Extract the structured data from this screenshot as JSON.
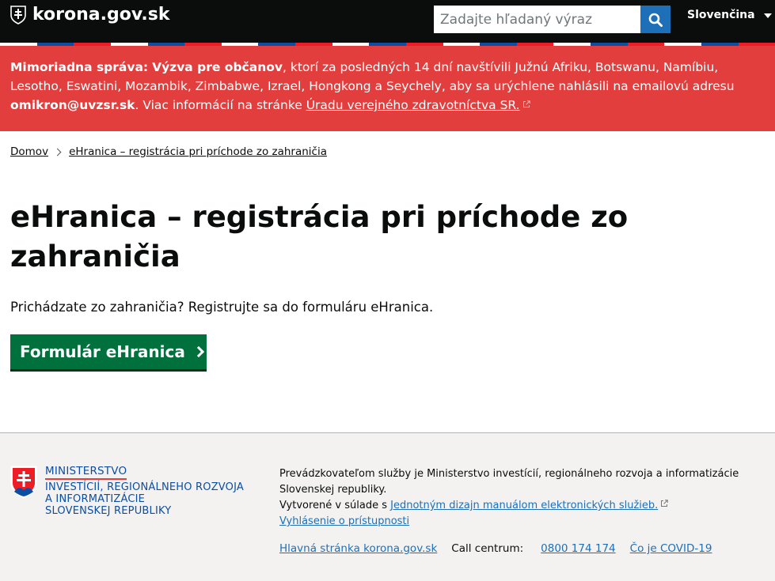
{
  "header": {
    "site_name": "korona.gov.sk",
    "search": {
      "placeholder": "Zadajte hľadaný výraz"
    },
    "language": "Slovenčina"
  },
  "alert": {
    "label": "Mimoriadna správa:",
    "headline": "Výzva pre občanov",
    "text_before_email": ", ktorí za posledných 14 dní navštívili Južnú Afriku, Botswanu, Namíbiu, Lesotho, Eswatini, Mozambik, Zimbabwe, Izrael, Hongkong a Seychely, aby sa urýchlene nahlásili na emailovú adresu ",
    "email": "omikron@uvzsr.sk",
    "text_after_email": ". Viac informácií na stránke ",
    "link": "Úradu verejného zdravotníctva SR."
  },
  "breadcrumb": {
    "home": "Domov",
    "current": "eHranica – registrácia pri príchode zo zahraničia"
  },
  "main": {
    "title": "eHranica – registrácia pri príchode zo zahraničia",
    "lead": "Prichádzate zo zahraničia? Registrujte sa do formuláru eHranica.",
    "cta": "Formulár eHranica"
  },
  "footer": {
    "ministry_logo": {
      "line1": "MINISTERSTVO",
      "line2": "INVESTÍCIÍ, REGIONÁLNEHO ROZVOJA",
      "line3": "A INFORMATIZÁCIE",
      "line4": "SLOVENSKEJ REPUBLIKY"
    },
    "operator": "Prevádzkovateľom služby je Ministerstvo investícií, regionálneho rozvoja a informatizácie Slovenskej republiky.",
    "created_prefix": "Vytvorené v súlade s ",
    "design_manual_link": "Jednotným dizajn manuálom elektronických služieb.",
    "accessibility_link": "Vyhlásenie o prístupnosti",
    "links": {
      "home": "Hlavná stránka korona.gov.sk",
      "call_label": "Call centrum:",
      "phone": "0800 174 174",
      "covid": "Čo je COVID-19"
    }
  },
  "colors": {
    "header_bg": "#0b0c0c",
    "alert_bg": "#e23e3e",
    "cta_bg": "#00703c",
    "link": "#1d70b8",
    "search_button": "#1d70b8",
    "footer_bg": "#f3f2f1",
    "ministry_blue": "#0b4ea2"
  }
}
